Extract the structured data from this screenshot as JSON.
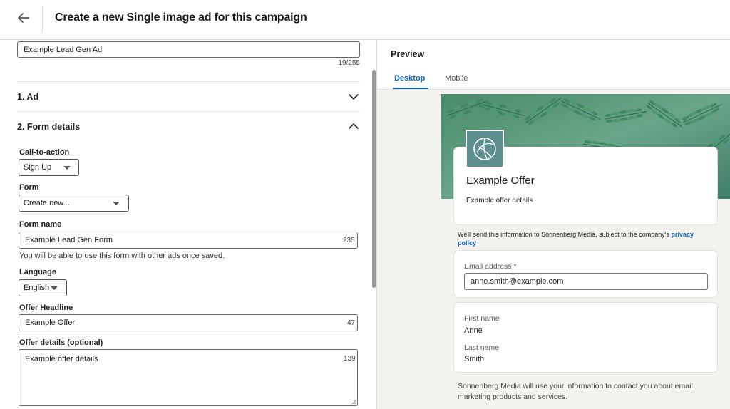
{
  "header": {
    "title": "Create a new Single image ad for this campaign"
  },
  "left": {
    "ad_name_value": "Example Lead Gen Ad",
    "ad_name_counter": "19/255",
    "sections": {
      "ad": "1.  Ad",
      "form_details": "2.  Form details"
    },
    "cta": {
      "label": "Call-to-action",
      "value": "Sign Up"
    },
    "form": {
      "label": "Form",
      "value": "Create new..."
    },
    "form_name": {
      "label": "Form name",
      "value": "Example Lead Gen Form",
      "counter": "235",
      "help": "You will be able to use this form with other ads once saved."
    },
    "language": {
      "label": "Language",
      "value": "English"
    },
    "offer_headline": {
      "label": "Offer Headline",
      "value": "Example Offer",
      "counter": "47"
    },
    "offer_details": {
      "label": "Offer details (optional)",
      "value": "Example offer details",
      "counter": "139"
    }
  },
  "preview": {
    "title": "Preview",
    "tabs": [
      {
        "label": "Desktop",
        "active": true
      },
      {
        "label": "Mobile",
        "active": false
      }
    ],
    "offer_title": "Example Offer",
    "offer_details": "Example offer details",
    "consent_text": "We'll send this information to Sonnenberg Media, subject to the company's ",
    "privacy_link": "privacy policy",
    "email": {
      "label": "Email address *",
      "value": "anne.smith@example.com"
    },
    "first_name": {
      "label": "First name",
      "value": "Anne"
    },
    "last_name": {
      "label": "Last name",
      "value": "Smith"
    },
    "footer_text": "Sonnenberg Media will use your information to contact you about email marketing products and services."
  },
  "colors": {
    "accent": "#0a66c2",
    "logo_bg": "#5d8f8e",
    "preview_bg": "#f3f2ef"
  },
  "icons": [
    "back-arrow-icon",
    "chevron-down-icon",
    "chevron-up-icon",
    "dropdown-caret-icon",
    "leaf-logo-icon",
    "resize-handle-icon"
  ]
}
